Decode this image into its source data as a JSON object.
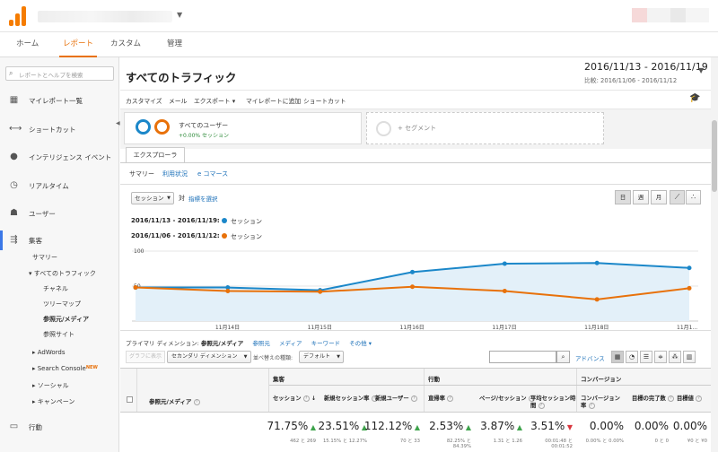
{
  "topnav": {
    "tabs": [
      "ホーム",
      "レポート",
      "カスタム",
      "管理"
    ],
    "active_tab": "レポート"
  },
  "colors": {
    "accent": "#e8710a",
    "link": "#1a6fb8",
    "series_current": "#1b87c9",
    "series_compare": "#e8710a",
    "up": "#3ea34b",
    "down": "#d9363e"
  },
  "sidebar": {
    "search_placeholder": "レポートとヘルプを検索",
    "items": [
      {
        "icon": "grid-icon",
        "label": "マイレポート一覧"
      },
      {
        "icon": "shortcut-arrow-icon",
        "label": "ショートカット"
      },
      {
        "icon": "lightbulb-icon",
        "label": "インテリジェンス イベント"
      },
      {
        "icon": "clock-icon",
        "label": "リアルタイム"
      },
      {
        "icon": "people-icon",
        "label": "ユーザー"
      },
      {
        "icon": "acquisition-icon",
        "label": "集客"
      }
    ],
    "acq_sub": {
      "summary": "サマリー",
      "all_traffic": "▾ すべてのトラフィック",
      "channel": "チャネル",
      "treemap": "ツリーマップ",
      "source_medium": "参照元/メディア",
      "referrals": "参照サイト",
      "adwords": "▸ AdWords",
      "search_console": "▸ Search Console",
      "new_badge": "NEW",
      "social": "▸ ソーシャル",
      "campaign": "▸ キャンペーン"
    },
    "behavior": {
      "icon": "behavior-icon",
      "label": "行動"
    }
  },
  "report": {
    "title": "すべてのトラフィック",
    "date_range": "2016/11/13 - 2016/11/19",
    "compare_range": "比較: 2016/11/06 - 2016/11/12",
    "toolbar": [
      "カスタマイズ",
      "メール",
      "エクスポート ▾",
      "マイレポートに追加",
      "ショートカット"
    ],
    "segment": {
      "name": "すべてのユーザー",
      "pct": "+0.00% セッション",
      "add_label": "+ セグメント"
    },
    "explorer_tab": "エクスプローラ",
    "subtabs": [
      "サマリー",
      "利用状況",
      "e コマース"
    ],
    "metric_select": "セッション",
    "vs": "対",
    "compare_link": "指標を選択",
    "period_buttons": [
      "日",
      "週",
      "月"
    ],
    "legend": [
      {
        "range": "2016/11/13 - 2016/11/19:",
        "metric": "セッション"
      },
      {
        "range": "2016/11/06 - 2016/11/12:",
        "metric": "セッション"
      }
    ],
    "dimension_bar": {
      "label": "プライマリ ディメンション:",
      "current": "参照元/メディア",
      "links": [
        "参照元",
        "メディア",
        "キーワード",
        "その他 ▾"
      ]
    },
    "controls": {
      "plot_rows": "グラフに表示",
      "secondary_dim": "セカンダリ ディメンション",
      "sort_label": "並べ替えの種類:",
      "sort_value": "デフォルト",
      "advanced": "アドバンス"
    }
  },
  "table": {
    "groups": [
      "集客",
      "行動",
      "コンバージョン"
    ],
    "dim_header": "参照元/メディア",
    "columns": [
      {
        "h1": "セッション",
        "h2": ""
      },
      {
        "h1": "新規セッション率",
        "h2": ""
      },
      {
        "h1": "新規ユーザー",
        "h2": ""
      },
      {
        "h1": "直帰率",
        "h2": ""
      },
      {
        "h1": "ページ/セッション",
        "h2": ""
      },
      {
        "h1": "平均セッション時",
        "h2": "間"
      },
      {
        "h1": "コンバージョン",
        "h2": "率"
      },
      {
        "h1": "目標の完了数",
        "h2": ""
      },
      {
        "h1": "目標値",
        "h2": ""
      }
    ],
    "totals": [
      {
        "value": "71.75%",
        "dir": "up",
        "sub1": "462 と 269",
        "sub2": ""
      },
      {
        "value": "23.51%",
        "dir": "up",
        "sub1": "15.15% と 12.27%",
        "sub2": ""
      },
      {
        "value": "112.12%",
        "dir": "up",
        "sub1": "70 と 33",
        "sub2": ""
      },
      {
        "value": "2.53%",
        "dir": "up",
        "sub1": "82.25% と",
        "sub2": "84.39%"
      },
      {
        "value": "3.87%",
        "dir": "up",
        "sub1": "1.31 と 1.26",
        "sub2": ""
      },
      {
        "value": "3.51%",
        "dir": "down",
        "sub1": "00:01:48 と",
        "sub2": "00:01:52"
      },
      {
        "value": "0.00%",
        "dir": "",
        "sub1": "0.00% と 0.00%",
        "sub2": ""
      },
      {
        "value": "0.00%",
        "dir": "",
        "sub1": "0 と 0",
        "sub2": ""
      },
      {
        "value": "0.00%",
        "dir": "",
        "sub1": "¥0 と ¥0",
        "sub2": ""
      }
    ]
  },
  "chart_data": {
    "type": "line",
    "x": [
      "11/13",
      "11/14",
      "11/15",
      "11/16",
      "11/17",
      "11/18",
      "11/19"
    ],
    "x_tick_labels": [
      "11月14日",
      "11月15日",
      "11月16日",
      "11月17日",
      "11月18日",
      "11月1..."
    ],
    "ylim": [
      0,
      100
    ],
    "y_ticks": [
      50,
      100
    ],
    "grid": true,
    "series": [
      {
        "name": "2016/11/13 - 2016/11/19: セッション",
        "values": [
          48,
          48,
          44,
          70,
          82,
          83,
          76
        ],
        "filled": true
      },
      {
        "name": "2016/11/06 - 2016/11/12: セッション",
        "values": [
          48,
          43,
          42,
          49,
          43,
          31,
          47
        ],
        "filled": false
      }
    ]
  }
}
